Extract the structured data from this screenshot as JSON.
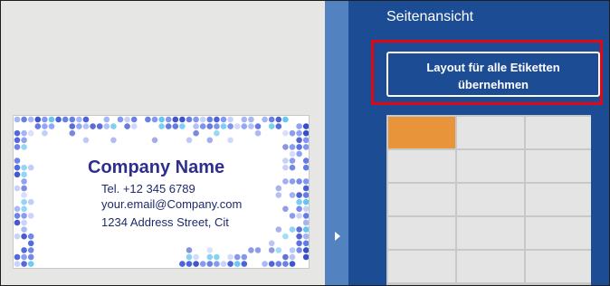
{
  "card": {
    "company_name": "Company Name",
    "phone": "Tel. +12 345 6789",
    "email": "your.email@Company.com",
    "address": "1234 Address Street, Cit"
  },
  "panel": {
    "title": "Seitenansicht",
    "apply_layout_label_line1": "Layout für alle Etiketten",
    "apply_layout_label_line2": "übernehmen"
  },
  "colors": {
    "panel_bg": "#1c4c94",
    "divider_bg": "#5283c0",
    "highlight": "#e30613",
    "selected_label": "#e8943a",
    "company_text": "#2e2e8e"
  },
  "label_grid": {
    "columns": 3,
    "rows": 5,
    "selected": [
      0,
      0
    ]
  }
}
